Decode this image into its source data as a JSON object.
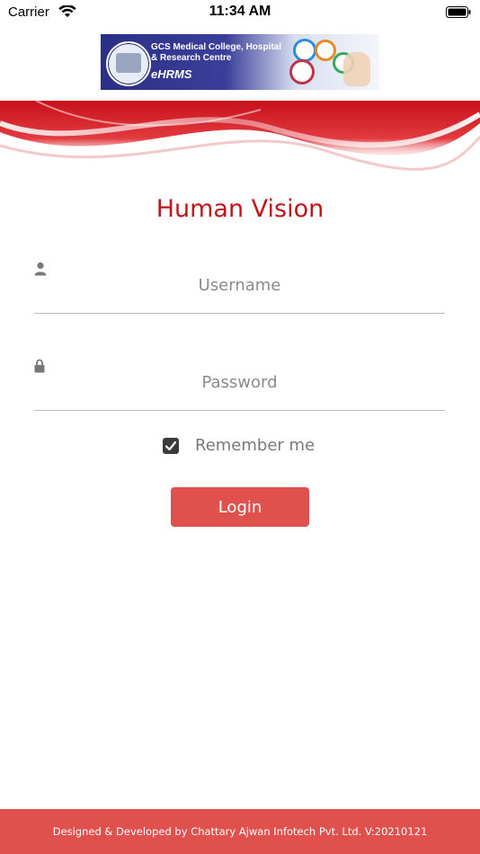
{
  "status_bar": {
    "carrier": "Carrier",
    "time": "11:34 AM"
  },
  "banner": {
    "title": "GCS Medical College, Hospital & Research Centre",
    "subtitle": "eHRMS"
  },
  "app": {
    "title": "Human Vision"
  },
  "login_form": {
    "username_placeholder": "Username",
    "password_placeholder": "Password",
    "remember_label": "Remember me",
    "remember_checked": true,
    "login_label": "Login"
  },
  "footer": {
    "text": "Designed & Developed by Chattary Ajwan Infotech Pvt. Ltd. V:20210121"
  },
  "colors": {
    "brand_red": "#e0504c",
    "title_red": "#c0151b"
  },
  "icons": {
    "username": "user-icon",
    "password": "lock-icon",
    "remember": "checkbox-checked-icon"
  }
}
